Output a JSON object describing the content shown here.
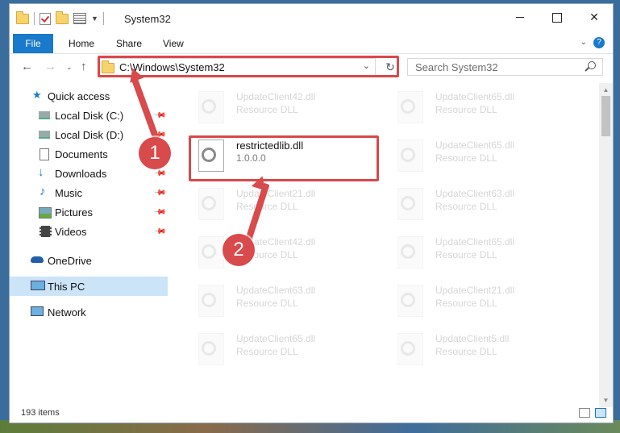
{
  "window": {
    "title": "System32"
  },
  "ribbon": {
    "tabs": [
      "File",
      "Home",
      "Share",
      "View"
    ],
    "help": "?"
  },
  "address": {
    "path": "C:\\Windows\\System32",
    "search_placeholder": "Search System32"
  },
  "sidebar": {
    "items": [
      {
        "label": "Quick access",
        "icon": "star-icon",
        "pinned": false
      },
      {
        "label": "Local Disk (C:)",
        "icon": "drive-icon",
        "pinned": true
      },
      {
        "label": "Local Disk (D:)",
        "icon": "drive-icon",
        "pinned": true
      },
      {
        "label": "Documents",
        "icon": "document-icon",
        "pinned": true
      },
      {
        "label": "Downloads",
        "icon": "download-icon",
        "pinned": true
      },
      {
        "label": "Music",
        "icon": "music-icon",
        "pinned": true
      },
      {
        "label": "Pictures",
        "icon": "pictures-icon",
        "pinned": true
      },
      {
        "label": "Videos",
        "icon": "video-icon",
        "pinned": true
      },
      {
        "label": "OneDrive",
        "icon": "cloud-icon",
        "pinned": false
      },
      {
        "label": "This PC",
        "icon": "computer-icon",
        "pinned": false,
        "selected": true
      },
      {
        "label": "Network",
        "icon": "network-icon",
        "pinned": false
      }
    ]
  },
  "files": [
    {
      "name": "UpdateClient42.dll",
      "desc": "Resource DLL"
    },
    {
      "name": "UpdateClient65.dll",
      "desc": "Resource DLL"
    },
    {
      "name": "restrictedlib.dll",
      "desc": "1.0.0.0",
      "highlighted": true
    },
    {
      "name": "UpdateClient65.dll",
      "desc": "Resource DLL"
    },
    {
      "name": "UpdateClient21.dll",
      "desc": "Resource DLL"
    },
    {
      "name": "UpdateClient63.dll",
      "desc": "Resource DLL"
    },
    {
      "name": "UpdateClient42.dll",
      "desc": "Resource DLL"
    },
    {
      "name": "UpdateClient65.dll",
      "desc": "Resource DLL"
    },
    {
      "name": "UpdateClient63.dll",
      "desc": "Resource DLL"
    },
    {
      "name": "UpdateClient21.dll",
      "desc": "Resource DLL"
    },
    {
      "name": "UpdateClient65.dll",
      "desc": "Resource DLL"
    },
    {
      "name": "UpdateClient5.dll",
      "desc": "Resource DLL"
    }
  ],
  "status": {
    "item_count": "193 items"
  },
  "annotations": {
    "step1": "1",
    "step2": "2",
    "color": "#d84a4b"
  }
}
